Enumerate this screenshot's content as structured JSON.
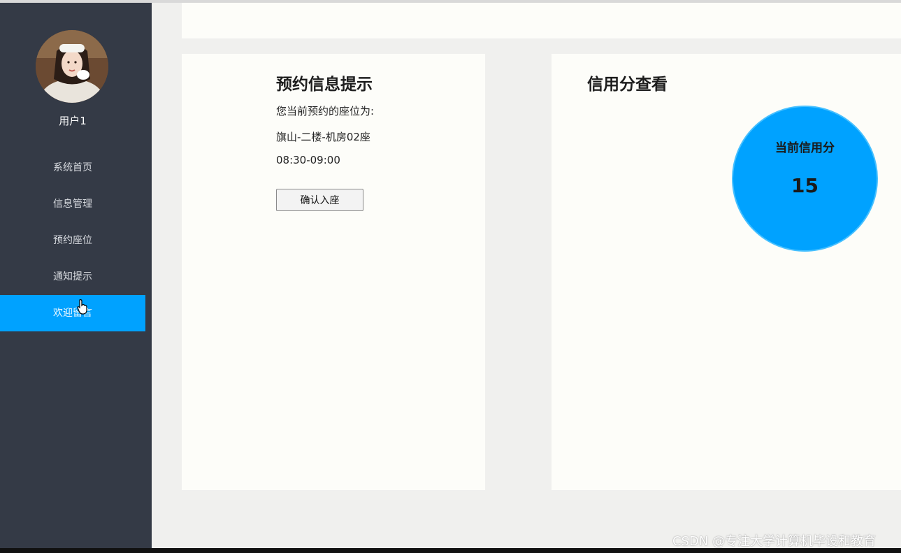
{
  "sidebar": {
    "username": "用户1",
    "items": [
      {
        "label": "系统首页",
        "active": false
      },
      {
        "label": "信息管理",
        "active": false
      },
      {
        "label": "预约座位",
        "active": false
      },
      {
        "label": "通知提示",
        "active": false
      },
      {
        "label": "欢迎留言",
        "active": true
      }
    ]
  },
  "reservation": {
    "title": "预约信息提示",
    "prompt": "您当前预约的座位为:",
    "seat": "旗山-二楼-机房02座",
    "time": "08:30-09:00",
    "confirm_label": "确认入座"
  },
  "credit": {
    "title": "信用分查看",
    "label": "当前信用分",
    "value": "15"
  },
  "watermark": "CSDN @专注大学计算机毕设和教育",
  "colors": {
    "sidebar_bg": "#343a46",
    "accent": "#00a2ff",
    "page_bg": "#f0f0ee",
    "card_bg": "#fdfdf9"
  }
}
